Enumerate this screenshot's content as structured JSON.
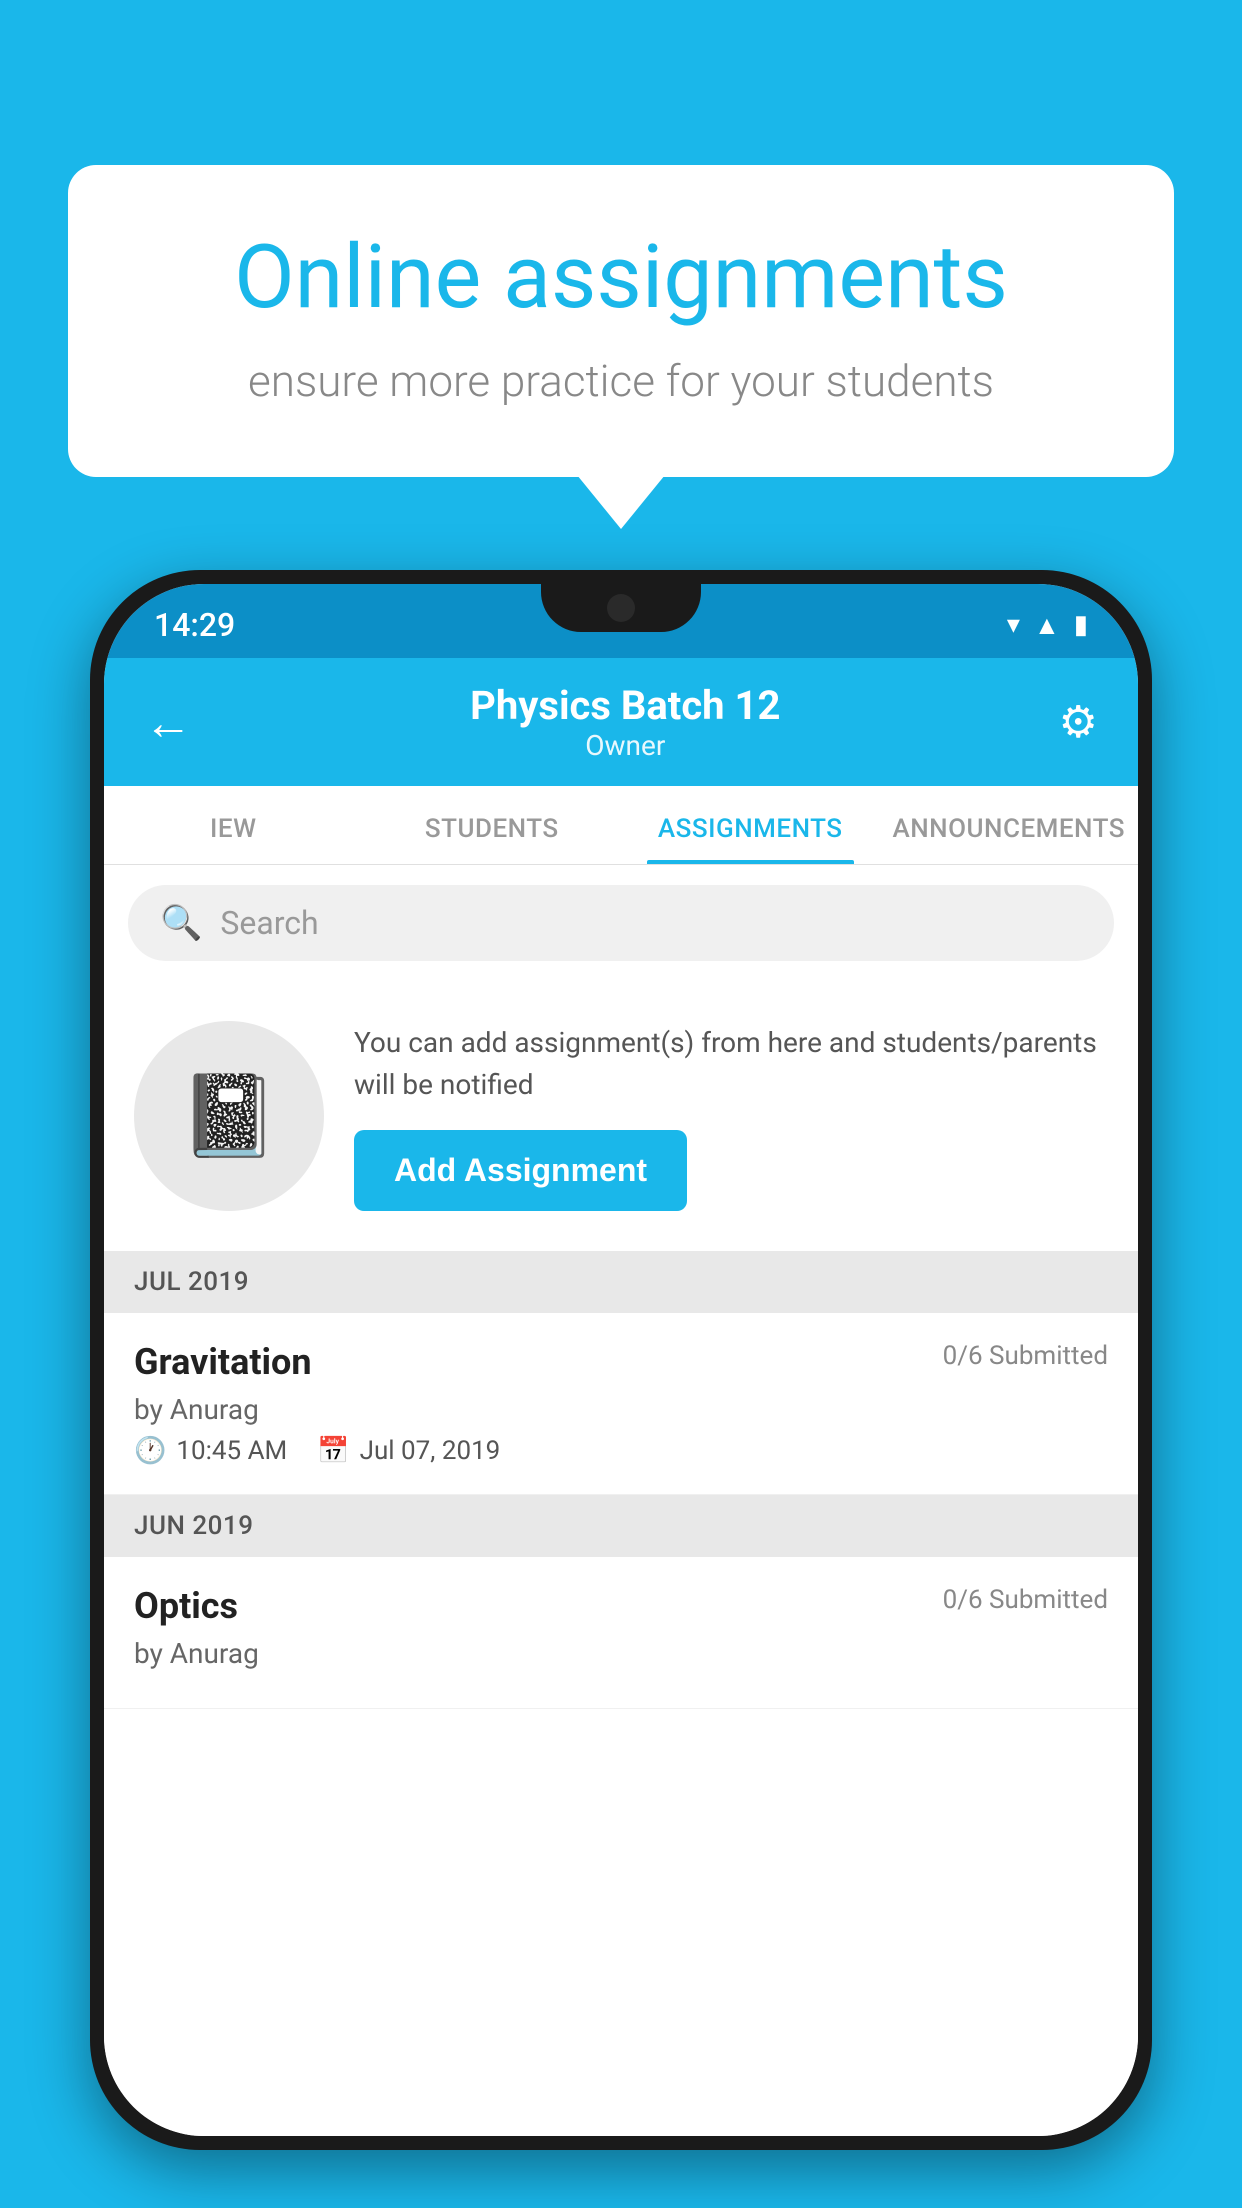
{
  "background_color": "#1ab7ea",
  "speech_bubble": {
    "title": "Online assignments",
    "subtitle": "ensure more practice for your students"
  },
  "phone": {
    "status_bar": {
      "time": "14:29",
      "icons": [
        "wifi",
        "signal",
        "battery"
      ]
    },
    "header": {
      "title": "Physics Batch 12",
      "subtitle": "Owner",
      "back_label": "←",
      "gear_label": "⚙"
    },
    "tabs": [
      {
        "label": "IEW",
        "active": false
      },
      {
        "label": "STUDENTS",
        "active": false
      },
      {
        "label": "ASSIGNMENTS",
        "active": true
      },
      {
        "label": "ANNOUNCEMENTS",
        "active": false
      }
    ],
    "search": {
      "placeholder": "Search"
    },
    "promo": {
      "description": "You can add assignment(s) from here and students/parents will be notified",
      "button_label": "Add Assignment"
    },
    "sections": [
      {
        "header": "JUL 2019",
        "assignments": [
          {
            "name": "Gravitation",
            "submitted": "0/6 Submitted",
            "by": "by Anurag",
            "time": "10:45 AM",
            "date": "Jul 07, 2019"
          }
        ]
      },
      {
        "header": "JUN 2019",
        "assignments": [
          {
            "name": "Optics",
            "submitted": "0/6 Submitted",
            "by": "by Anurag",
            "time": "",
            "date": ""
          }
        ]
      }
    ]
  }
}
